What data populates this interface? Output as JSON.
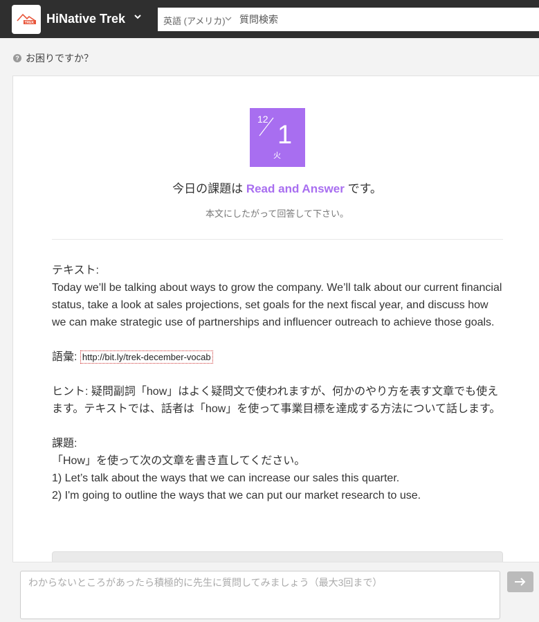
{
  "header": {
    "brand": "HiNative Trek",
    "logo_text": "TREK",
    "language": "英語 (アメリカ)",
    "search_placeholder": "質問検索",
    "colors": {
      "bar": "#2f2f2f",
      "logo_accent": "#e8553a"
    }
  },
  "help": {
    "label": "お困りですか？"
  },
  "lesson": {
    "date": {
      "month": "12",
      "day": "1",
      "weekday": "火",
      "color": "#a86ef0"
    },
    "task_prefix": "今日の課題は",
    "task_name": "Read and Answer",
    "task_suffix": "です。",
    "task_sub": "本文にしたがって回答して下さい。"
  },
  "content": {
    "text_label": "テキスト:",
    "text_body": "Today we’ll be talking about ways to grow the company. We’ll talk about our current financial status, take a look at sales projections, set goals for the next fiscal year, and discuss how we can make strategic use of partnerships and influencer outreach to achieve those goals.",
    "vocab_label": "語彙:",
    "vocab_link": "http://bit.ly/trek-december-vocab",
    "hint": "ヒント: 疑問副詞「how」はよく疑問文で使われますが、何かのやり方を表す文章でも使えます。テキストでは、話者は「how」を使って事業目標を達成する方法について話します。",
    "task_label": "課題:",
    "task_instruction": "「How」を使って次の文章を書き直してください。",
    "task_1": "1) Let’s talk about the ways that we can increase our sales this quarter.",
    "task_2": "2) I'm going to outline the ways that we can put our market research to use."
  },
  "bottom": {
    "question_placeholder": "わからないところがあったら積極的に先生に質問してみましょう（最大3回まで）",
    "send_icon": "arrow-right-icon"
  }
}
